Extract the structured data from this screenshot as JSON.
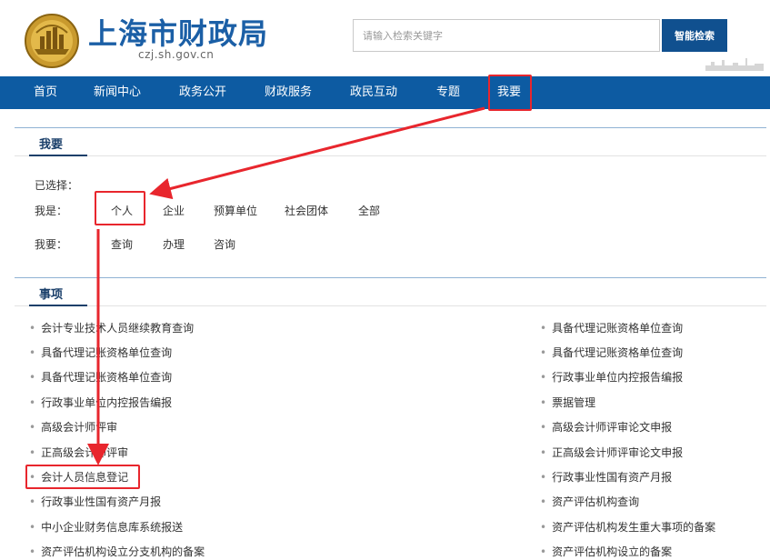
{
  "header": {
    "site_title": "上海市财政局",
    "domain": "czj.sh.gov.cn",
    "search": {
      "placeholder": "请输入检索关键字",
      "value": "",
      "button_label": "智能检索"
    }
  },
  "nav": {
    "items": [
      {
        "label": "首页"
      },
      {
        "label": "新闻中心"
      },
      {
        "label": "政务公开"
      },
      {
        "label": "财政服务"
      },
      {
        "label": "政民互动"
      },
      {
        "label": "专题"
      },
      {
        "label": "我要"
      }
    ]
  },
  "woyao_section": {
    "title": "我要",
    "selected_label": "已选择：",
    "identity_label": "我是：",
    "identity_options": [
      "个人",
      "企业",
      "预算单位",
      "社会团体",
      "全部"
    ],
    "action_label": "我要：",
    "action_options": [
      "查询",
      "办理",
      "咨询"
    ]
  },
  "items_section": {
    "title": "事项",
    "left_items": [
      "会计专业技术人员继续教育查询",
      "具备代理记账资格单位查询",
      "具备代理记账资格单位查询",
      "行政事业单位内控报告编报",
      "高级会计师评审",
      "正高级会计师评审",
      "会计人员信息登记",
      "行政事业性国有资产月报",
      "中小企业财务信息库系统报送",
      "资产评估机构设立分支机构的备案"
    ],
    "right_items": [
      "具备代理记账资格单位查询",
      "具备代理记账资格单位查询",
      "行政事业单位内控报告编报",
      "票据管理",
      "高级会计师评审论文申报",
      "正高级会计师评审论文申报",
      "行政事业性国有资产月报",
      "资产评估机构查询",
      "资产评估机构发生重大事项的备案",
      "资产评估机构设立的备案"
    ],
    "bullet": "•"
  },
  "colors": {
    "brand_blue": "#0d5ba2",
    "title_blue": "#1b5fa6",
    "annotation_red": "#e8262d"
  }
}
